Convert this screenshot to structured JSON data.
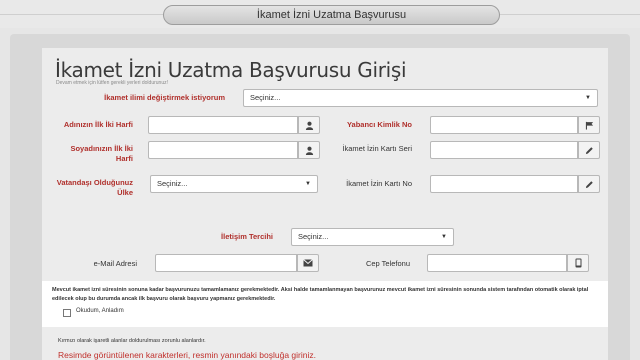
{
  "header": {
    "title": "İkamet İzni Uzatma Başvurusu"
  },
  "form": {
    "title": "İkamet İzni Uzatma Başvurusu Girişi",
    "subtitle": "Devam etmek için lütfen gerekli yerleri doldurunuz!",
    "change_place": {
      "label": "İkamet ilimi değiştirmek istiyorum",
      "value": "Seçiniz..."
    },
    "first_name": {
      "label": "Adınızın İlk İki Harfi",
      "value": "",
      "icon": "user-icon"
    },
    "foreign_id": {
      "label": "Yabancı Kimlik No",
      "value": "",
      "icon": "flag-icon"
    },
    "last_name": {
      "label": "Soyadınızın İlk İki Harfi",
      "value": "",
      "icon": "user-icon"
    },
    "card_series": {
      "label": "İkamet İzin Kartı Seri",
      "value": "",
      "icon": "pencil-icon"
    },
    "nationality": {
      "label": "Vatandaşı Olduğunuz Ülke",
      "value": "Seçiniz..."
    },
    "card_no": {
      "label": "İkamet İzin Kartı No",
      "value": "",
      "icon": "pencil-icon"
    },
    "contact_pref": {
      "label": "İletişim Tercihi",
      "value": "Seçiniz..."
    },
    "email": {
      "label": "e-Mail Adresi",
      "value": "",
      "icon": "envelope-icon"
    },
    "phone": {
      "label": "Cep Telefonu",
      "value": "",
      "icon": "mobile-icon"
    }
  },
  "notice": {
    "text": "Mevcut ikamet izni süresinin sonuna kadar başvurunuzu tamamlamanız gerekmektedir. Aksi halde tamamlanmayan başvurunuz mevcut ikamet izni süresinin sonunda sistem tarafından otomatik olarak iptal edilecek olup bu durumda ancak ilk başvuru olarak başvuru yapmanız gerekmektedir.",
    "checkbox_label": "Okudum, Anladım",
    "checked": false
  },
  "required_note": "Kırmızı olarak işaretli alanlar doldurulması zorunlu alanlardır.",
  "captcha_note": "Resimde görüntülenen karakterleri, resmin yanındaki boşluğa giriniz."
}
